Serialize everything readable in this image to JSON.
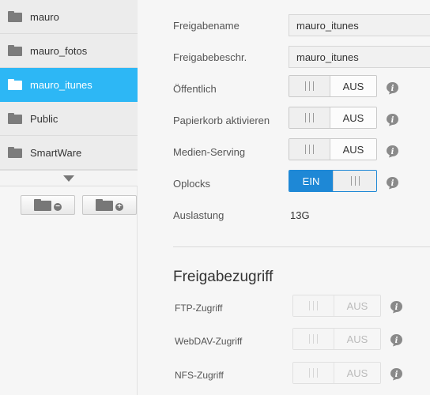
{
  "sidebar": {
    "shares": [
      {
        "label": "mauro",
        "selected": false
      },
      {
        "label": "mauro_fotos",
        "selected": false
      },
      {
        "label": "mauro_itunes",
        "selected": true
      },
      {
        "label": "Public",
        "selected": false
      },
      {
        "label": "SmartWare",
        "selected": false
      }
    ],
    "remove_icon": "folder-remove-icon",
    "add_icon": "folder-add-icon",
    "remove_badge": "−",
    "add_badge": "+"
  },
  "settings": {
    "share_name": {
      "label": "Freigabename",
      "value": "mauro_itunes"
    },
    "share_description": {
      "label": "Freigabebeschr.",
      "value": "mauro_itunes"
    },
    "public": {
      "label": "Öffentlich",
      "state": "AUS"
    },
    "recycle_bin": {
      "label": "Papierkorb aktivieren",
      "state": "AUS"
    },
    "media_serving": {
      "label": "Medien-Serving",
      "state": "AUS"
    },
    "oplocks": {
      "label": "Oplocks",
      "state": "EIN"
    },
    "usage": {
      "label": "Auslastung",
      "value": "13G"
    }
  },
  "access": {
    "title": "Freigabezugriff",
    "ftp": {
      "label": "FTP-Zugriff",
      "state": "AUS"
    },
    "webdav": {
      "label": "WebDAV-Zugriff",
      "state": "AUS"
    },
    "nfs": {
      "label": "NFS-Zugriff",
      "state": "AUS"
    }
  },
  "info_icon_glyph": "i",
  "colors": {
    "selected": "#2db7f5",
    "toggle_on": "#1e88d6",
    "info": "#8a8a8a"
  }
}
